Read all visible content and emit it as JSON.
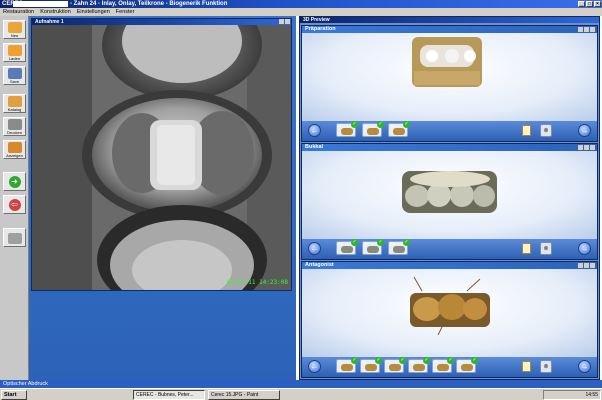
{
  "window": {
    "app_name": "CEREC",
    "title": "- Zahn 24 - Inlay, Onlay, Teilkrone - Biogenerik Funktion",
    "buttons": [
      "_",
      "□",
      "×"
    ]
  },
  "menu": [
    "Restauration",
    "Konstruktion",
    "Einstellungen",
    "Fenster"
  ],
  "toolbar": [
    {
      "name": "Neu",
      "icon": "tooth-icon",
      "color": "#e8a63a"
    },
    {
      "name": "Laden",
      "icon": "folder-icon",
      "color": "#f0a030"
    },
    {
      "name": "Save",
      "icon": "save-icon",
      "color": "#5a7ab8"
    },
    {
      "name": "Katalog",
      "icon": "catalog-icon",
      "color": "#e0a040"
    },
    {
      "name": "Drucken",
      "icon": "print-icon",
      "color": "#8a8a8a"
    },
    {
      "name": "Anzeigen",
      "icon": "view-icon",
      "color": "#d88a2a"
    },
    {
      "name": "",
      "icon": "forward-arrow-icon",
      "color": "#2eaa2e"
    },
    {
      "name": "",
      "icon": "back-arrow-icon",
      "color": "#cc4444"
    },
    {
      "name": "",
      "icon": "camera-icon",
      "color": "#a0a0a0"
    }
  ],
  "capture_panel": {
    "title": "Aufnahme 1",
    "timestamp": "09.01.11 14:23:08"
  },
  "preview_panel": {
    "title": "3D Preview",
    "sections": [
      {
        "title": "Präparation",
        "thumbs": [
          "01",
          "02",
          "03"
        ]
      },
      {
        "title": "Bukkal",
        "thumbs": [
          "01",
          "02",
          "03"
        ]
      },
      {
        "title": "Antagonist",
        "thumbs": [
          "01",
          "02",
          "03",
          "04",
          "05",
          "06"
        ]
      }
    ]
  },
  "status_text": "Optischer Abdruck",
  "taskbar": {
    "start": "Start",
    "tasks": [
      "CEREC - Bubnes, Peter...",
      "Cerec 15.JPG - Paint"
    ],
    "clock": "14:55"
  },
  "colors": {
    "accent": "#2c63b8",
    "check": "#2fb62f",
    "timestamp": "#2cff2c"
  }
}
